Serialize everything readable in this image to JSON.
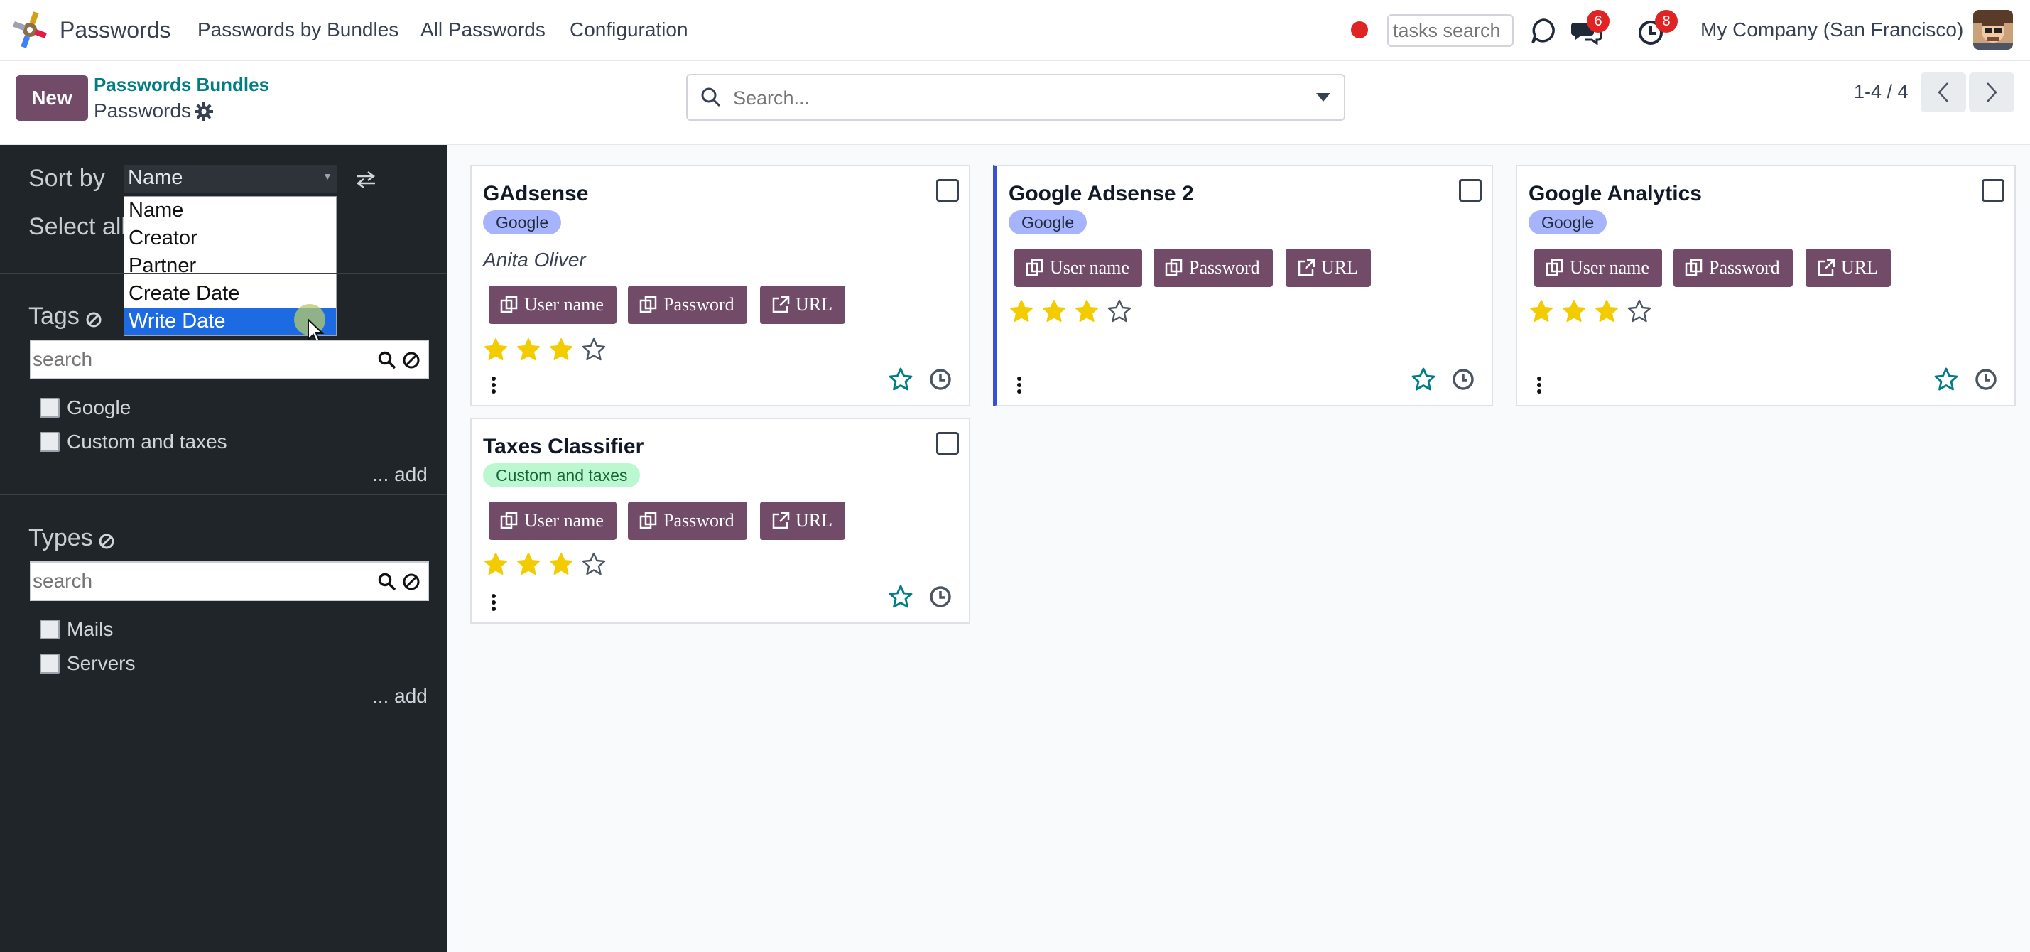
{
  "navbar": {
    "app_name": "Passwords",
    "menu": [
      "Passwords by Bundles",
      "All Passwords",
      "Configuration"
    ],
    "tasks_search_placeholder": "tasks search",
    "messages_badge": "6",
    "activities_badge": "8",
    "company": "My Company (San Francisco)"
  },
  "control": {
    "new_label": "New",
    "breadcrumb_parent": "Passwords Bundles",
    "breadcrumb_current": "Passwords",
    "search_placeholder": "Search...",
    "pager": "1-4 / 4"
  },
  "sidebar": {
    "sort_by_label": "Sort by",
    "sort_value": "Name",
    "sort_options": [
      "Name",
      "Creator",
      "Partner",
      "Create Date",
      "Write Date"
    ],
    "select_all_label": "Select all",
    "tags": {
      "title": "Tags",
      "search_placeholder": "search",
      "items": [
        "Google",
        "Custom and taxes"
      ],
      "add_label": "... add"
    },
    "types": {
      "title": "Types",
      "search_placeholder": "search",
      "items": [
        "Mails",
        "Servers"
      ],
      "add_label": "... add"
    }
  },
  "button_labels": {
    "username": "User name",
    "password": "Password",
    "url": "URL"
  },
  "cards": [
    {
      "title": "GAdsense",
      "tag": "Google",
      "partner": "Anita Oliver",
      "rating": 3,
      "max_rating": 4
    },
    {
      "title": "Google Adsense 2",
      "tag": "Google",
      "partner": "",
      "rating": 3,
      "max_rating": 4
    },
    {
      "title": "Google Analytics",
      "tag": "Google",
      "partner": "",
      "rating": 3,
      "max_rating": 4
    },
    {
      "title": "Taxes Classifier",
      "tag": "Custom and taxes",
      "partner": "",
      "rating": 3,
      "max_rating": 4
    }
  ],
  "colors": {
    "primary": "#714b67",
    "star_filled": "#f3cc00",
    "link_teal": "#017e84",
    "badge_red": "#e02424",
    "tag_blue": "#a5b4fc",
    "tag_green": "#bbf7d0"
  }
}
